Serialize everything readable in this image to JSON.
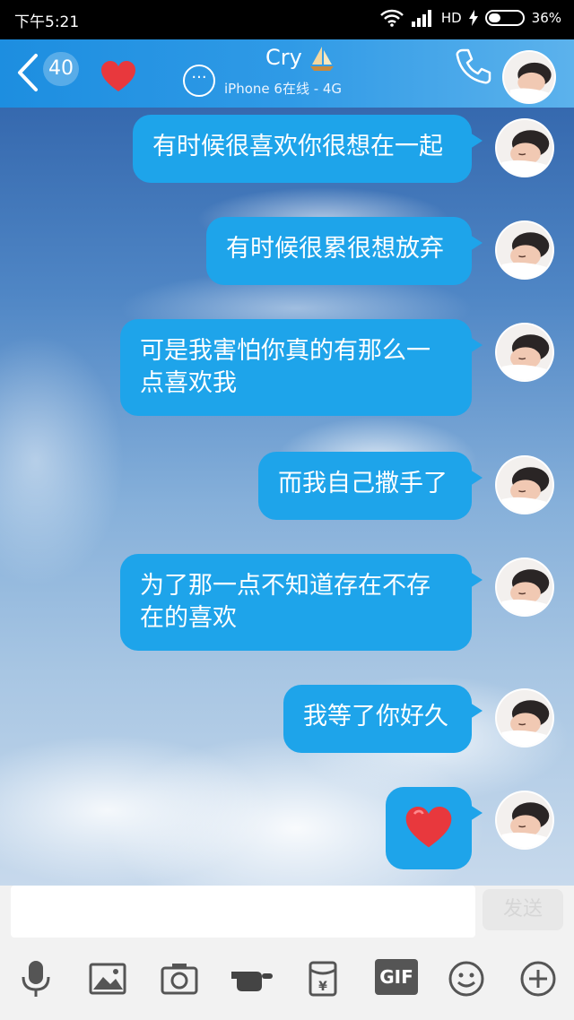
{
  "status_bar": {
    "time": "下午5:21",
    "network": "HD",
    "battery": "36%",
    "battery_level": 0.36
  },
  "header": {
    "unread_count": "40",
    "contact_name": "Cry",
    "contact_status": "iPhone 6在线 - 4G",
    "accent": "#2f9ae6"
  },
  "messages": [
    {
      "text": "有时候很喜欢你很想在一起"
    },
    {
      "text": "有时候很累很想放弃"
    },
    {
      "text": "可是我害怕你真的有那么一点喜欢我"
    },
    {
      "text": "而我自己撒手了"
    },
    {
      "text": "为了那一点不知道存在不存在的喜欢"
    },
    {
      "text": "我等了你好久"
    },
    {
      "text": "",
      "icon": "heart-icon"
    }
  ],
  "input": {
    "placeholder": "",
    "send_label": "发送"
  },
  "toolbar": {
    "icons": [
      "microphone-icon",
      "image-icon",
      "camera-icon",
      "poke-hand-icon",
      "red-packet-icon",
      "gif-icon",
      "emoji-icon",
      "plus-icon"
    ],
    "gif_label": "GIF",
    "red_packet_label": "¥"
  },
  "colors": {
    "bubble": "#1ea4ea",
    "heart": "#e8383d"
  }
}
